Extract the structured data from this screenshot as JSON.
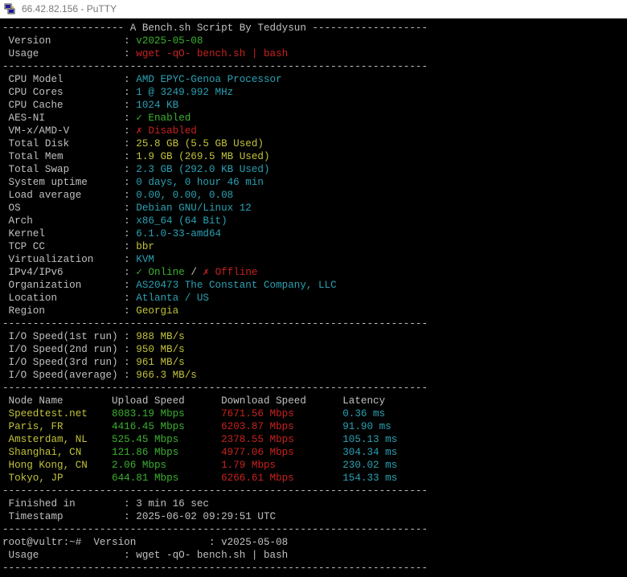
{
  "window": {
    "title": "66.42.82.156 - PuTTY",
    "icon": "putty-icon"
  },
  "colors": {
    "background": "#000000",
    "default_text": "#c0c0c0",
    "green": "#3cb030",
    "yellow": "#c2c23a",
    "cyan": "#2aa1b3",
    "red": "#c8221f"
  },
  "terminal": {
    "lines": [
      [
        {
          "t": "-------------------- A Bench.sh Script By Teddysun -------------------",
          "c": "w"
        }
      ],
      [
        {
          "t": " Version            : ",
          "c": "w"
        },
        {
          "t": "v2025-05-08",
          "c": "g"
        }
      ],
      [
        {
          "t": " Usage              : ",
          "c": "w"
        },
        {
          "t": "wget -qO- bench.sh | bash",
          "c": "r"
        }
      ],
      [
        {
          "t": "----------------------------------------------------------------------",
          "c": "w"
        }
      ],
      [
        {
          "t": " CPU Model          : ",
          "c": "w"
        },
        {
          "t": "AMD EPYC-Genoa Processor",
          "c": "c"
        }
      ],
      [
        {
          "t": " CPU Cores          : ",
          "c": "w"
        },
        {
          "t": "1 @ 3249.992 MHz",
          "c": "c"
        }
      ],
      [
        {
          "t": " CPU Cache          : ",
          "c": "w"
        },
        {
          "t": "1024 KB",
          "c": "c"
        }
      ],
      [
        {
          "t": " AES-NI             : ",
          "c": "w"
        },
        {
          "t": "✓ Enabled",
          "c": "g"
        }
      ],
      [
        {
          "t": " VM-x/AMD-V         : ",
          "c": "w"
        },
        {
          "t": "✗ Disabled",
          "c": "r"
        }
      ],
      [
        {
          "t": " Total Disk         : ",
          "c": "w"
        },
        {
          "t": "25.8 GB (5.5 GB Used)",
          "c": "y"
        }
      ],
      [
        {
          "t": " Total Mem          : ",
          "c": "w"
        },
        {
          "t": "1.9 GB (269.5 MB Used)",
          "c": "y"
        }
      ],
      [
        {
          "t": " Total Swap         : ",
          "c": "w"
        },
        {
          "t": "2.3 GB (292.0 KB Used)",
          "c": "c"
        }
      ],
      [
        {
          "t": " System uptime      : ",
          "c": "w"
        },
        {
          "t": "0 days, 0 hour 46 min",
          "c": "c"
        }
      ],
      [
        {
          "t": " Load average       : ",
          "c": "w"
        },
        {
          "t": "0.00, 0.00, 0.08",
          "c": "c"
        }
      ],
      [
        {
          "t": " OS                 : ",
          "c": "w"
        },
        {
          "t": "Debian GNU/Linux 12",
          "c": "c"
        }
      ],
      [
        {
          "t": " Arch               : ",
          "c": "w"
        },
        {
          "t": "x86_64 (64 Bit)",
          "c": "c"
        }
      ],
      [
        {
          "t": " Kernel             : ",
          "c": "w"
        },
        {
          "t": "6.1.0-33-amd64",
          "c": "c"
        }
      ],
      [
        {
          "t": " TCP CC             : ",
          "c": "w"
        },
        {
          "t": "bbr",
          "c": "y"
        }
      ],
      [
        {
          "t": " Virtualization     : ",
          "c": "w"
        },
        {
          "t": "KVM",
          "c": "c"
        }
      ],
      [
        {
          "t": " IPv4/IPv6          : ",
          "c": "w"
        },
        {
          "t": "✓ Online",
          "c": "g"
        },
        {
          "t": " / ",
          "c": "w"
        },
        {
          "t": "✗ Offline",
          "c": "r"
        }
      ],
      [
        {
          "t": " Organization       : ",
          "c": "w"
        },
        {
          "t": "AS20473 The Constant Company, LLC",
          "c": "c"
        }
      ],
      [
        {
          "t": " Location           : ",
          "c": "w"
        },
        {
          "t": "Atlanta / US",
          "c": "c"
        }
      ],
      [
        {
          "t": " Region             : ",
          "c": "w"
        },
        {
          "t": "Georgia",
          "c": "y"
        }
      ],
      [
        {
          "t": "----------------------------------------------------------------------",
          "c": "w"
        }
      ],
      [
        {
          "t": " I/O Speed(1st run) : ",
          "c": "w"
        },
        {
          "t": "988 MB/s",
          "c": "y"
        }
      ],
      [
        {
          "t": " I/O Speed(2nd run) : ",
          "c": "w"
        },
        {
          "t": "950 MB/s",
          "c": "y"
        }
      ],
      [
        {
          "t": " I/O Speed(3rd run) : ",
          "c": "w"
        },
        {
          "t": "961 MB/s",
          "c": "y"
        }
      ],
      [
        {
          "t": " I/O Speed(average) : ",
          "c": "w"
        },
        {
          "t": "966.3 MB/s",
          "c": "y"
        }
      ],
      [
        {
          "t": "----------------------------------------------------------------------",
          "c": "w"
        }
      ],
      [
        {
          "t": " Node Name        Upload Speed      Download Speed      Latency",
          "c": "w"
        }
      ],
      [
        {
          "t": " Speedtest.net    ",
          "c": "y"
        },
        {
          "t": "8083.19 Mbps      ",
          "c": "g"
        },
        {
          "t": "7671.56 Mbps        ",
          "c": "r"
        },
        {
          "t": "0.36 ms",
          "c": "c"
        }
      ],
      [
        {
          "t": " Paris, FR        ",
          "c": "y"
        },
        {
          "t": "4416.45 Mbps      ",
          "c": "g"
        },
        {
          "t": "6203.87 Mbps        ",
          "c": "r"
        },
        {
          "t": "91.90 ms",
          "c": "c"
        }
      ],
      [
        {
          "t": " Amsterdam, NL    ",
          "c": "y"
        },
        {
          "t": "525.45 Mbps       ",
          "c": "g"
        },
        {
          "t": "2378.55 Mbps        ",
          "c": "r"
        },
        {
          "t": "105.13 ms",
          "c": "c"
        }
      ],
      [
        {
          "t": " Shanghai, CN     ",
          "c": "y"
        },
        {
          "t": "121.86 Mbps       ",
          "c": "g"
        },
        {
          "t": "4977.06 Mbps        ",
          "c": "r"
        },
        {
          "t": "304.34 ms",
          "c": "c"
        }
      ],
      [
        {
          "t": " Hong Kong, CN    ",
          "c": "y"
        },
        {
          "t": "2.06 Mbps         ",
          "c": "g"
        },
        {
          "t": "1.79 Mbps           ",
          "c": "r"
        },
        {
          "t": "230.02 ms",
          "c": "c"
        }
      ],
      [
        {
          "t": " Tokyo, JP        ",
          "c": "y"
        },
        {
          "t": "644.81 Mbps       ",
          "c": "g"
        },
        {
          "t": "6266.61 Mbps        ",
          "c": "r"
        },
        {
          "t": "154.33 ms",
          "c": "c"
        }
      ],
      [
        {
          "t": "----------------------------------------------------------------------",
          "c": "w"
        }
      ],
      [
        {
          "t": " Finished in        : 3 min 16 sec",
          "c": "w"
        }
      ],
      [
        {
          "t": " Timestamp          : 2025-06-02 09:29:51 UTC",
          "c": "w"
        }
      ],
      [
        {
          "t": "----------------------------------------------------------------------",
          "c": "w"
        }
      ],
      [
        {
          "t": "root@vultr:~#  Version            : v2025-05-08",
          "c": "w"
        }
      ],
      [
        {
          "t": " Usage              : wget -qO- bench.sh | bash",
          "c": "w"
        }
      ],
      [
        {
          "t": "----------------------------------------------------------------------",
          "c": "w"
        }
      ]
    ]
  }
}
